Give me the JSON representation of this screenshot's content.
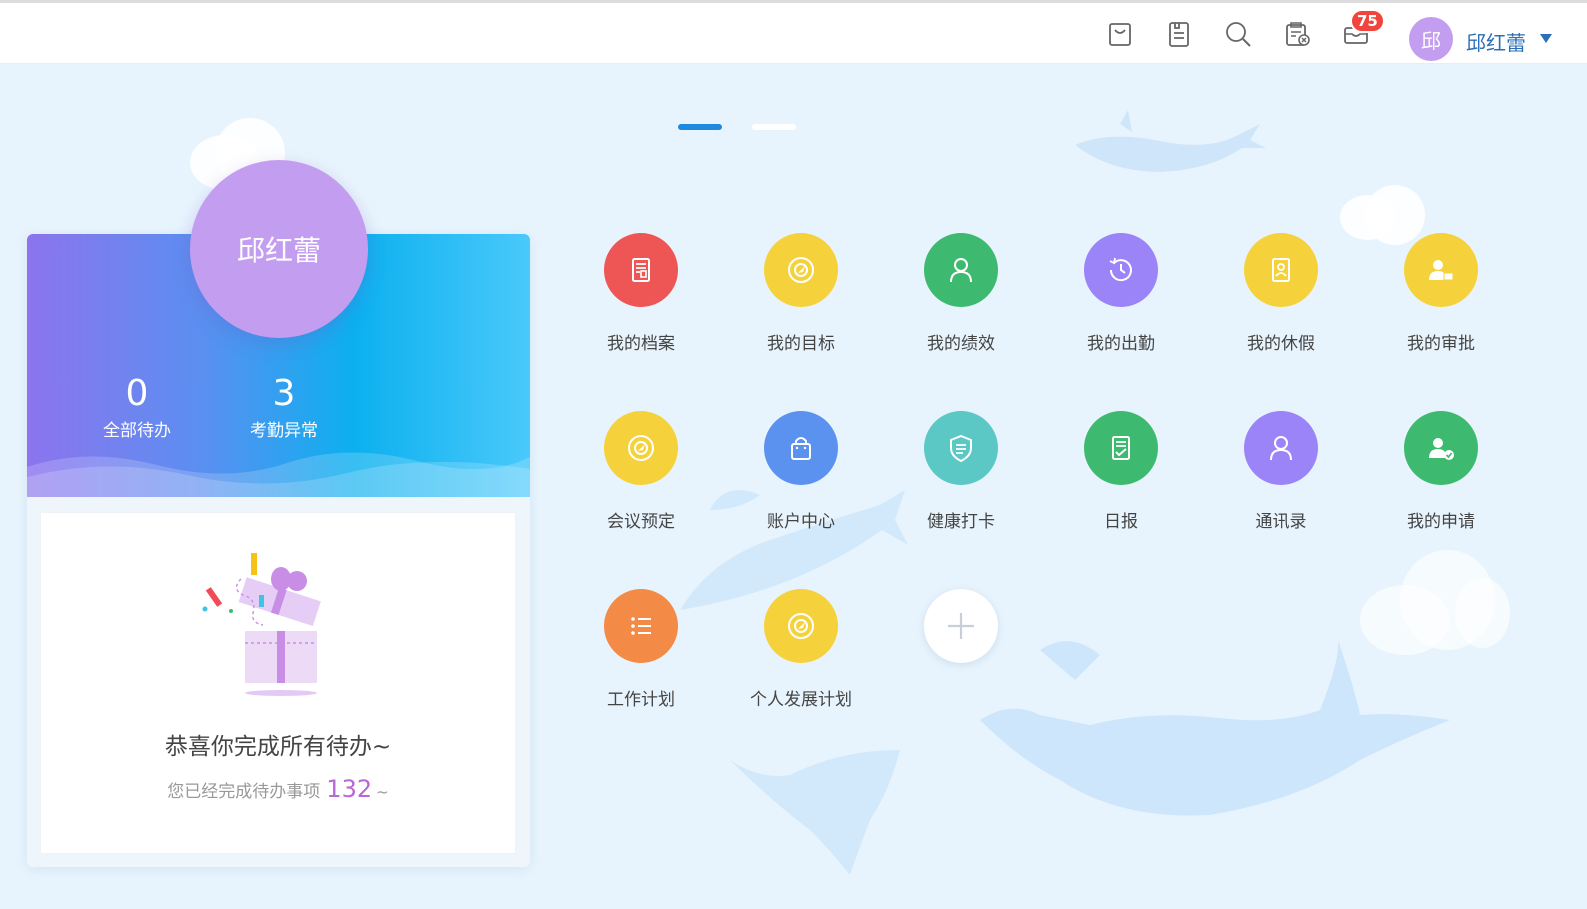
{
  "header": {
    "icons": [
      "shopping-bag-icon",
      "document-icon",
      "search-icon",
      "approval-icon",
      "mail-icon"
    ],
    "mail_badge": "75",
    "avatar_text": "邱",
    "user_name": "邱红蕾"
  },
  "profile": {
    "avatar_name": "邱红蕾",
    "stats": [
      {
        "value": "0",
        "label": "全部待办"
      },
      {
        "value": "3",
        "label": "考勤异常"
      }
    ],
    "congrats_text": "恭喜你完成所有待办~",
    "done_prefix": "您已经完成待办事项",
    "done_count": "132",
    "done_suffix": "~"
  },
  "carousel": {
    "active_index": 0,
    "total": 2
  },
  "apps": [
    {
      "label": "我的档案",
      "icon": "archive-icon",
      "color": "#ee5656"
    },
    {
      "label": "我的目标",
      "icon": "target-icon",
      "color": "#f5d23b"
    },
    {
      "label": "我的绩效",
      "icon": "person-icon",
      "color": "#3dba6f"
    },
    {
      "label": "我的出勤",
      "icon": "clock-history-icon",
      "color": "#9b84f7"
    },
    {
      "label": "我的休假",
      "icon": "leave-document-icon",
      "color": "#f5d23b"
    },
    {
      "label": "我的审批",
      "icon": "user-approval-icon",
      "color": "#f5d23b"
    },
    {
      "label": "会议预定",
      "icon": "meeting-target-icon",
      "color": "#f5d23b"
    },
    {
      "label": "账户中心",
      "icon": "bag-icon",
      "color": "#5b92ef"
    },
    {
      "label": "健康打卡",
      "icon": "health-shield-icon",
      "color": "#5cc8c6"
    },
    {
      "label": "日报",
      "icon": "daily-report-icon",
      "color": "#3dba6f"
    },
    {
      "label": "通讯录",
      "icon": "contacts-icon",
      "color": "#9b84f7"
    },
    {
      "label": "我的申请",
      "icon": "user-check-icon",
      "color": "#3dba6f"
    },
    {
      "label": "工作计划",
      "icon": "list-icon",
      "color": "#f38a46"
    },
    {
      "label": "个人发展计划",
      "icon": "development-target-icon",
      "color": "#f5d23b"
    }
  ],
  "add_app": {
    "icon": "plus-icon"
  }
}
